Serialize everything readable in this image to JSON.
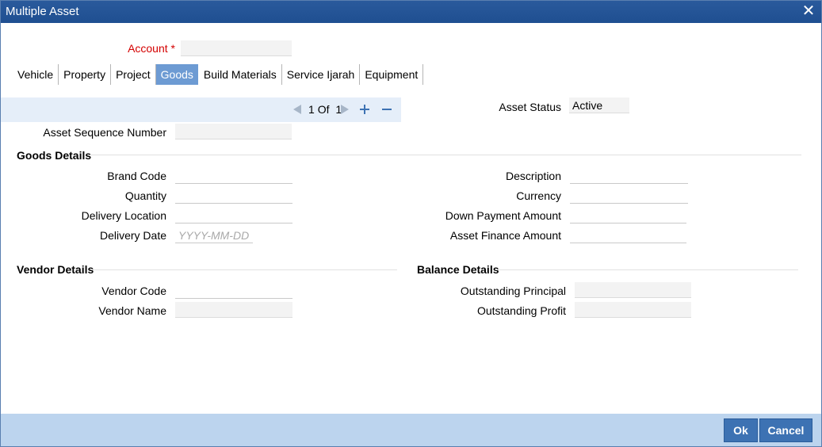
{
  "window": {
    "title": "Multiple Asset",
    "close_glyph": "✕"
  },
  "account": {
    "label": "Account",
    "required_mark": "*",
    "value": ""
  },
  "tabs": [
    {
      "label": "Vehicle"
    },
    {
      "label": "Property"
    },
    {
      "label": "Project"
    },
    {
      "label": "Goods",
      "active": true
    },
    {
      "label": "Build Materials"
    },
    {
      "label": "Service Ijarah"
    },
    {
      "label": "Equipment"
    }
  ],
  "pager": {
    "current": "1",
    "of_label": "Of",
    "total": "1"
  },
  "asset_status": {
    "label": "Asset Status",
    "value": "Active"
  },
  "asset_sequence": {
    "label": "Asset Sequence Number",
    "value": ""
  },
  "goods": {
    "heading": "Goods Details",
    "brand_code": {
      "label": "Brand Code",
      "value": ""
    },
    "quantity": {
      "label": "Quantity",
      "value": ""
    },
    "delivery_location": {
      "label": "Delivery Location",
      "value": ""
    },
    "delivery_date": {
      "label": "Delivery Date",
      "placeholder": "YYYY-MM-DD"
    },
    "description": {
      "label": "Description",
      "value": ""
    },
    "currency": {
      "label": "Currency",
      "value": ""
    },
    "down_payment": {
      "label": "Down Payment Amount",
      "value": ""
    },
    "asset_finance": {
      "label": "Asset Finance Amount",
      "value": ""
    }
  },
  "vendor": {
    "heading": "Vendor Details",
    "code": {
      "label": "Vendor Code",
      "value": ""
    },
    "name": {
      "label": "Vendor Name",
      "value": ""
    }
  },
  "balance": {
    "heading": "Balance Details",
    "outstanding_principal": {
      "label": "Outstanding Principal",
      "value": ""
    },
    "outstanding_profit": {
      "label": "Outstanding Profit",
      "value": ""
    }
  },
  "footer": {
    "ok_label": "Ok",
    "cancel_label": "Cancel"
  },
  "colors": {
    "titlebar": "#1f4f91",
    "active_tab": "#6d9bd3",
    "footer": "#bcd4ee",
    "button": "#3d72b3",
    "required": "#d40000"
  }
}
